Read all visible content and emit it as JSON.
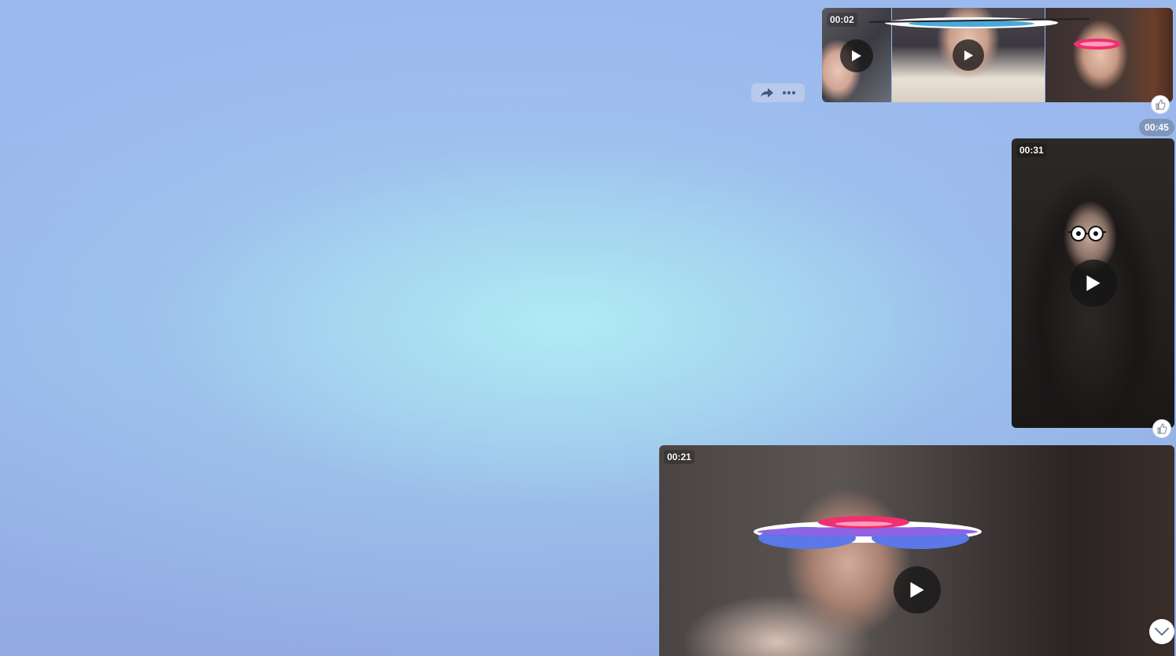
{
  "conversation": {
    "messages": [
      {
        "type": "video-album",
        "videos": [
          {
            "duration": "00:02"
          },
          {
            "duration": ""
          },
          {
            "duration": ""
          }
        ]
      },
      {
        "type": "time",
        "time": "00:45"
      },
      {
        "type": "video",
        "duration": "00:31"
      },
      {
        "type": "video",
        "duration": "00:21"
      }
    ]
  },
  "icons": {
    "share": "share-icon",
    "more": "more-icon",
    "like": "thumbs-up-icon",
    "play": "play-icon",
    "scroll": "chevron-down-icon"
  },
  "colors": {
    "background": "#98b5ea",
    "time_pill": "#7f95b9"
  }
}
